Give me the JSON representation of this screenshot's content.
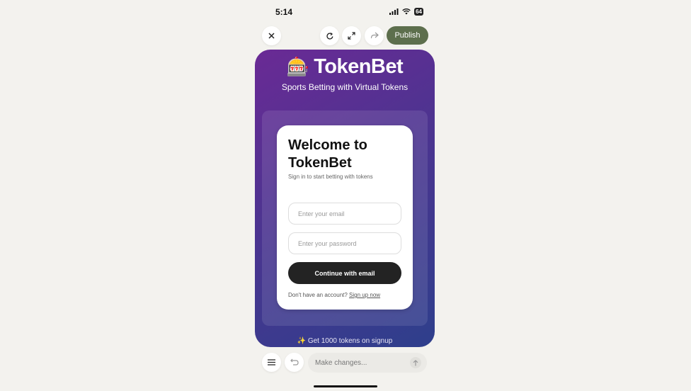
{
  "status": {
    "time": "5:14",
    "battery": "64"
  },
  "toolbar": {
    "close_icon": "close-icon",
    "refresh_icon": "refresh-icon",
    "expand_icon": "expand-icon",
    "share_icon": "share-icon",
    "publish_label": "Publish",
    "publish_color": "#5d6f4d"
  },
  "app": {
    "emoji": "🎰",
    "title": "TokenBet",
    "subtitle": "Sports Betting with Virtual Tokens",
    "gradient": [
      "#6a2a95",
      "#4c3490",
      "#2e3f8c"
    ]
  },
  "login": {
    "title": "Welcome to TokenBet",
    "subtitle": "Sign in to start betting with tokens",
    "email_placeholder": "Enter your email",
    "password_placeholder": "Enter your password",
    "cta_label": "Continue with email",
    "signup_prompt": "Don't have an account?",
    "signup_link": "Sign up now"
  },
  "bonus": "✨ Get 1000 tokens on signup",
  "bottom": {
    "menu_icon": "menu-icon",
    "undo_icon": "undo-icon",
    "input_placeholder": "Make changes...",
    "send_icon": "send-arrow-icon"
  }
}
